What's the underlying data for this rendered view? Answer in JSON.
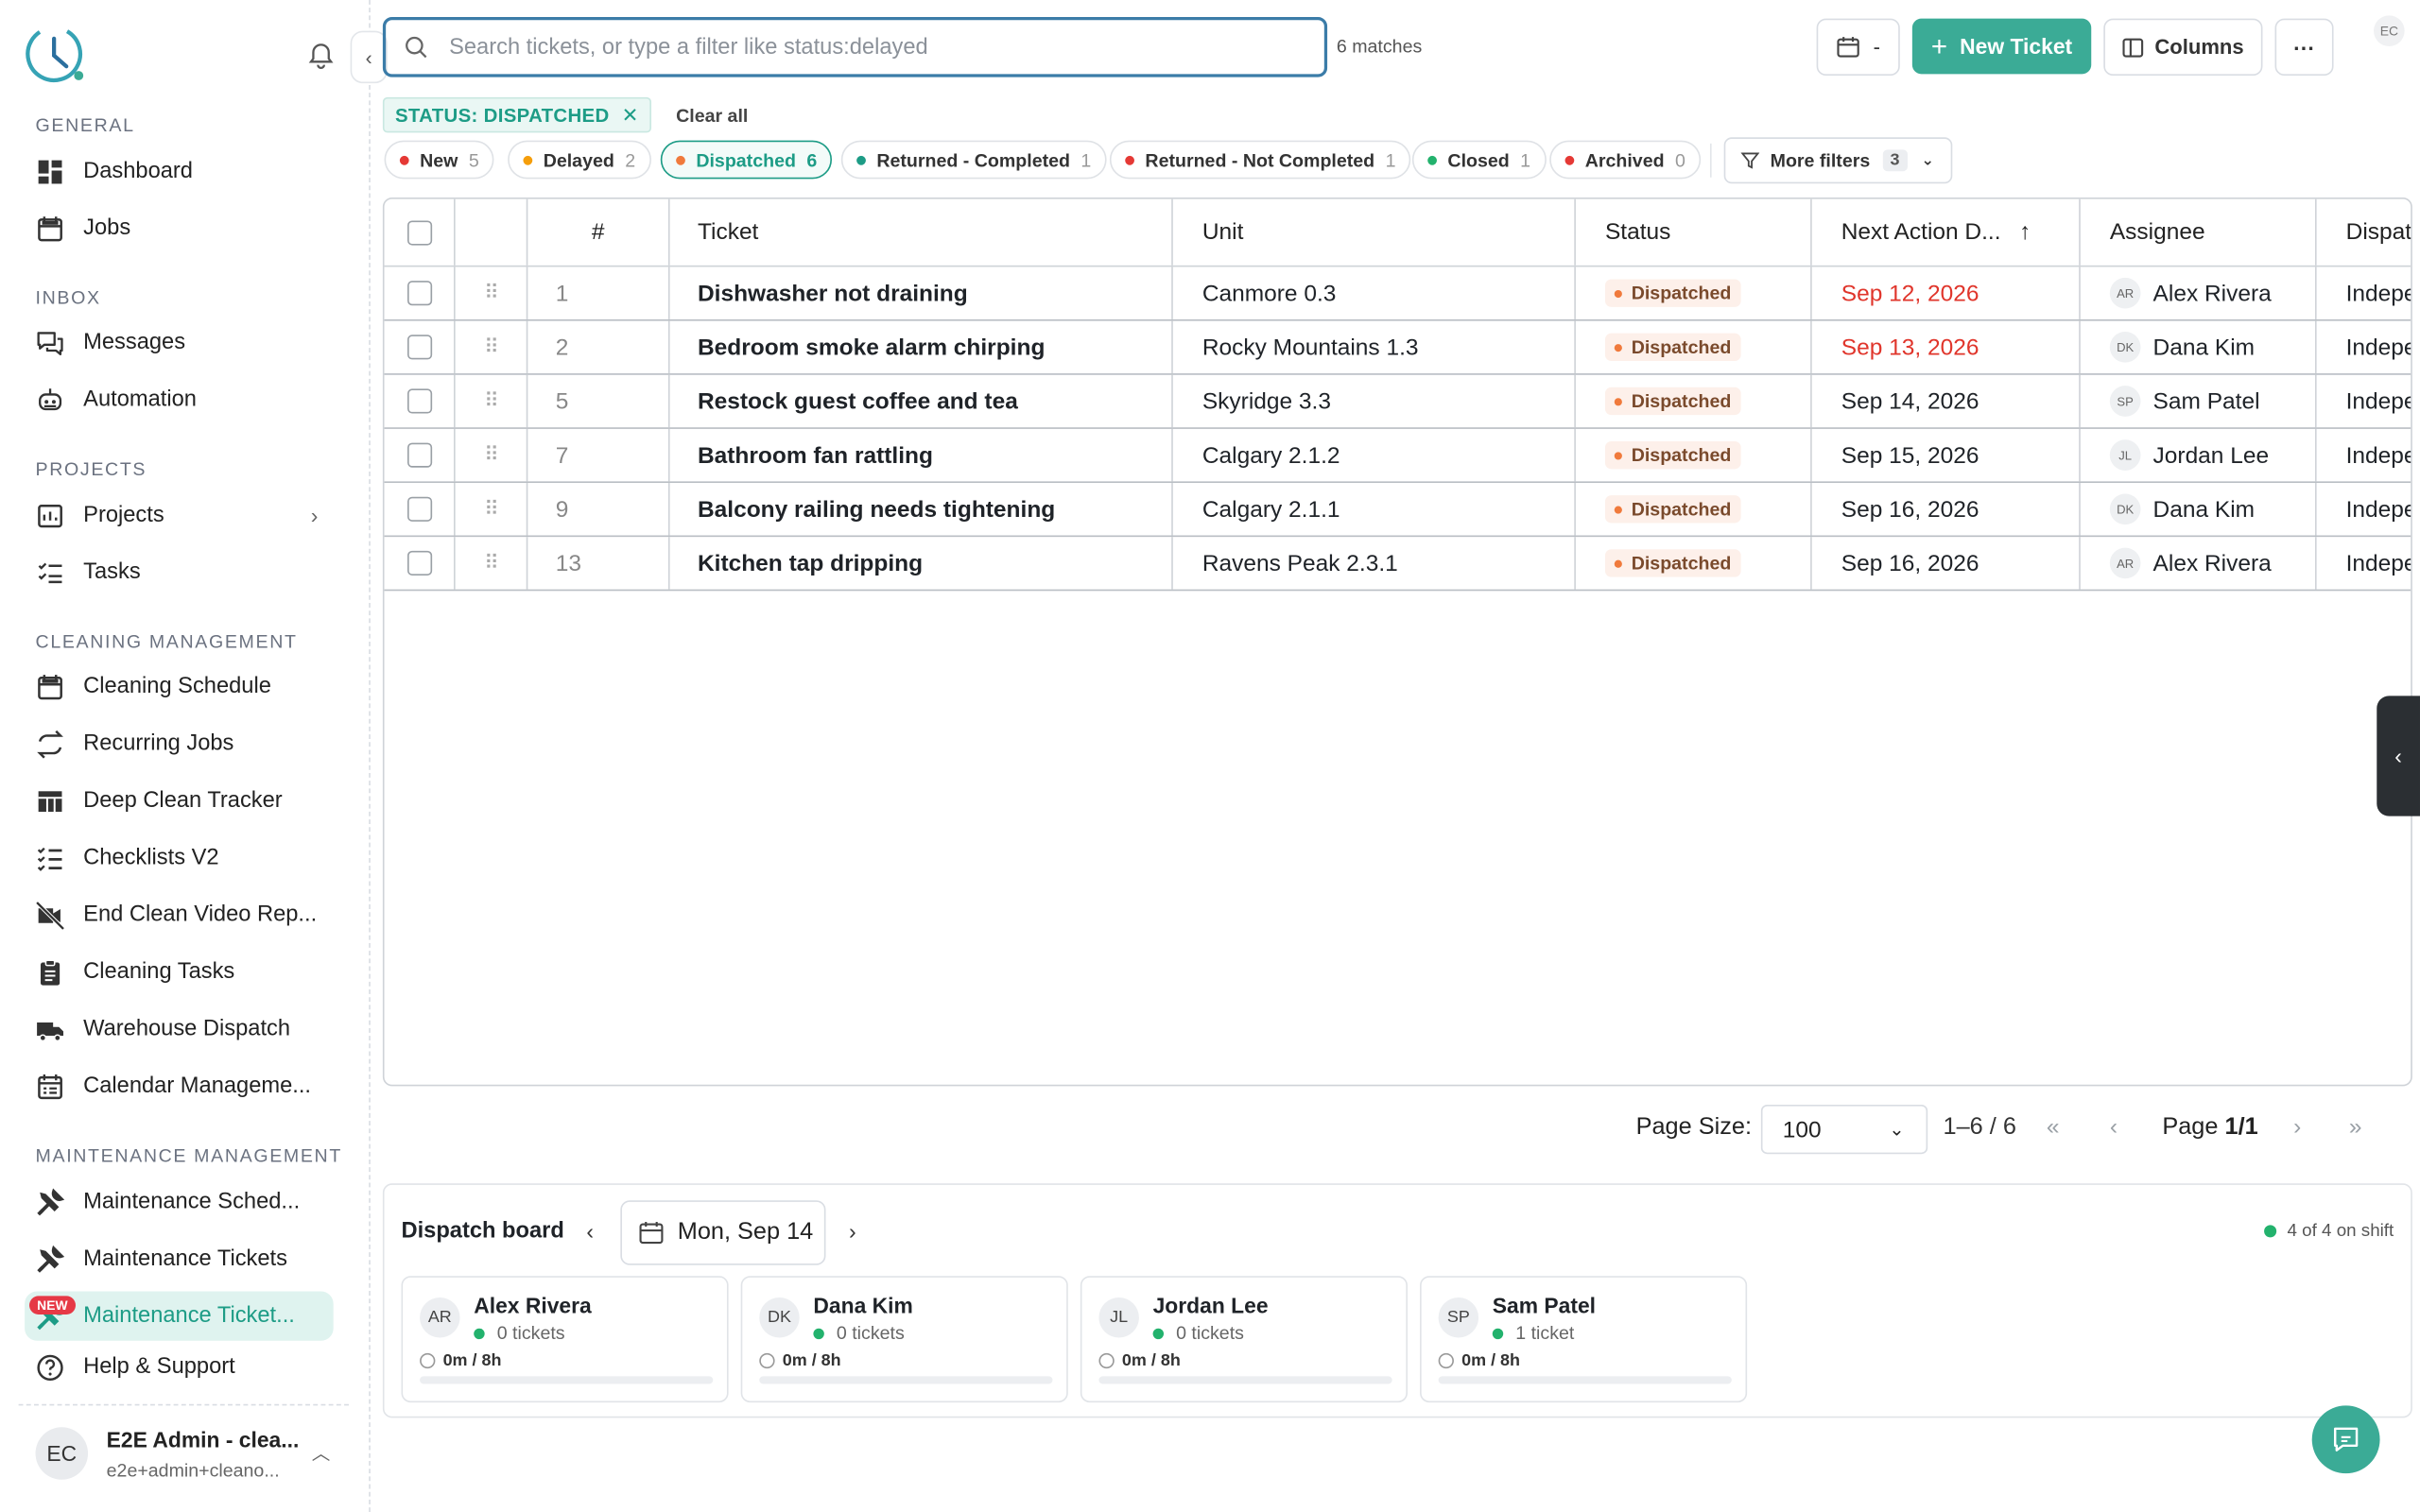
{
  "sidebar": {
    "sections": [
      {
        "label": "GENERAL",
        "items": [
          {
            "label": "Dashboard",
            "icon": "dashboard-icon"
          },
          {
            "label": "Jobs",
            "icon": "calendar-icon"
          }
        ]
      },
      {
        "label": "INBOX",
        "items": [
          {
            "label": "Messages",
            "icon": "messages-icon"
          },
          {
            "label": "Automation",
            "icon": "robot-icon"
          }
        ]
      },
      {
        "label": "PROJECTS",
        "items": [
          {
            "label": "Projects",
            "icon": "projects-icon"
          },
          {
            "label": "Tasks",
            "icon": "tasks-icon"
          }
        ]
      },
      {
        "label": "CLEANING MANAGEMENT",
        "items": [
          {
            "label": "Cleaning Schedule",
            "icon": "calendar-icon"
          },
          {
            "label": "Recurring Jobs",
            "icon": "repeat-icon"
          },
          {
            "label": "Deep Clean Tracker",
            "icon": "table-icon"
          },
          {
            "label": "Checklists V2",
            "icon": "checklist-icon"
          },
          {
            "label": "End Clean Video Rep...",
            "icon": "video-off-icon"
          },
          {
            "label": "Cleaning Tasks",
            "icon": "clipboard-icon"
          },
          {
            "label": "Warehouse Dispatch",
            "icon": "truck-icon"
          },
          {
            "label": "Calendar Manageme...",
            "icon": "calendar-list-icon"
          }
        ]
      },
      {
        "label": "MAINTENANCE MANAGEMENT",
        "items": [
          {
            "label": "Maintenance Sched...",
            "icon": "tools-icon"
          },
          {
            "label": "Maintenance Tickets",
            "icon": "tools-icon"
          },
          {
            "label": "Maintenance Ticket...",
            "icon": "tools-icon"
          },
          {
            "label": "Help & Support",
            "icon": "help-icon"
          }
        ]
      }
    ],
    "new_badge": "NEW",
    "user": {
      "initials": "EC",
      "name": "E2E Admin - clea...",
      "email": "e2e+admin+cleano..."
    }
  },
  "topbar": {
    "search_placeholder": "Search tickets, or type a filter like status:delayed",
    "matches": "6 matches",
    "date_label": "-",
    "new_ticket": "New Ticket",
    "columns": "Columns",
    "more": "···",
    "user_initials": "EC"
  },
  "filters": {
    "active_chip": "STATUS: DISPATCHED",
    "clear_all": "Clear all",
    "chips": [
      {
        "label": "New",
        "count": "5",
        "color": "#e53935"
      },
      {
        "label": "Delayed",
        "count": "2",
        "color": "#f59e0b"
      },
      {
        "label": "Dispatched",
        "count": "6",
        "color": "#f07a3c"
      },
      {
        "label": "Returned - Completed",
        "count": "1",
        "color": "#1d9c86"
      },
      {
        "label": "Returned - Not Completed",
        "count": "1",
        "color": "#e53935"
      },
      {
        "label": "Closed",
        "count": "1",
        "color": "#23b26d"
      },
      {
        "label": "Archived",
        "count": "0",
        "color": "#e53935"
      }
    ],
    "more_filters": "More filters",
    "more_count": "3"
  },
  "table": {
    "headers": {
      "num": "#",
      "ticket": "Ticket",
      "unit": "Unit",
      "status": "Status",
      "next_action": "Next Action D...",
      "assignee": "Assignee",
      "dispatch": "Dispat"
    },
    "rows": [
      {
        "num": "1",
        "ticket": "Dishwasher not draining",
        "unit": "Canmore 0.3",
        "status": "Dispatched",
        "date": "Sep 12, 2026",
        "overdue": true,
        "initials": "AR",
        "assignee": "Alex Rivera",
        "dispatch": "Indepe"
      },
      {
        "num": "2",
        "ticket": "Bedroom smoke alarm chirping",
        "unit": "Rocky Mountains 1.3",
        "status": "Dispatched",
        "date": "Sep 13, 2026",
        "overdue": true,
        "initials": "DK",
        "assignee": "Dana Kim",
        "dispatch": "Indepe"
      },
      {
        "num": "5",
        "ticket": "Restock guest coffee and tea",
        "unit": "Skyridge 3.3",
        "status": "Dispatched",
        "date": "Sep 14, 2026",
        "overdue": false,
        "initials": "SP",
        "assignee": "Sam Patel",
        "dispatch": "Indepe"
      },
      {
        "num": "7",
        "ticket": "Bathroom fan rattling",
        "unit": "Calgary 2.1.2",
        "status": "Dispatched",
        "date": "Sep 15, 2026",
        "overdue": false,
        "initials": "JL",
        "assignee": "Jordan Lee",
        "dispatch": "Indepe"
      },
      {
        "num": "9",
        "ticket": "Balcony railing needs tightening",
        "unit": "Calgary 2.1.1",
        "status": "Dispatched",
        "date": "Sep 16, 2026",
        "overdue": false,
        "initials": "DK",
        "assignee": "Dana Kim",
        "dispatch": "Indepe"
      },
      {
        "num": "13",
        "ticket": "Kitchen tap dripping",
        "unit": "Ravens Peak 2.3.1",
        "status": "Dispatched",
        "date": "Sep 16, 2026",
        "overdue": false,
        "initials": "AR",
        "assignee": "Alex Rivera",
        "dispatch": "Indepe"
      }
    ]
  },
  "pagination": {
    "page_size_label": "Page Size:",
    "page_size": "100",
    "range": "1–6 / 6",
    "page_prefix": "Page",
    "page": "1/1"
  },
  "board": {
    "title": "Dispatch board",
    "date": "Mon, Sep 14",
    "on_shift": "4 of 4 on shift",
    "cards": [
      {
        "initials": "AR",
        "name": "Alex Rivera",
        "tickets": "0 tickets",
        "hours": "0m / 8h"
      },
      {
        "initials": "DK",
        "name": "Dana Kim",
        "tickets": "0 tickets",
        "hours": "0m / 8h"
      },
      {
        "initials": "JL",
        "name": "Jordan Lee",
        "tickets": "0 tickets",
        "hours": "0m / 8h"
      },
      {
        "initials": "SP",
        "name": "Sam Patel",
        "tickets": "1 ticket",
        "hours": "0m / 8h"
      }
    ]
  }
}
